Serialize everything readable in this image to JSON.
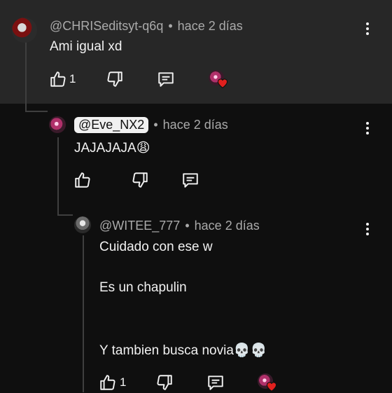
{
  "comments": [
    {
      "handle": "@CHRISeditsyt-q6q",
      "time": "hace 2 días",
      "lines": [
        "Ami igual xd"
      ],
      "likes": "1"
    },
    {
      "handle": "@Eve_NX2",
      "time": "hace 2 días",
      "lines": [
        "JAJAJAJA😩"
      ],
      "likes": ""
    },
    {
      "handle": "@WITEE_777",
      "time": "hace 2 días",
      "lines": [
        "Cuidado con ese w",
        "Es un chapulin",
        "Y tambien busca novia💀💀"
      ],
      "likes": "1"
    }
  ],
  "separator": "•",
  "colors": {
    "background": "#0f0f0f",
    "highlight": "#272727",
    "text": "#f1f1f1",
    "meta": "#aaaaaa",
    "heart": "#e0201e"
  },
  "icons": [
    "like-icon",
    "dislike-icon",
    "reply-icon",
    "more-vert-icon",
    "creator-heart-icon"
  ]
}
